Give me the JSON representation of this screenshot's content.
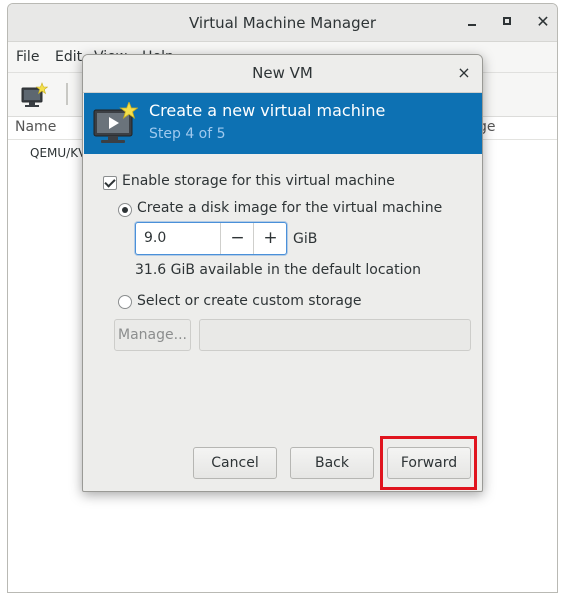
{
  "main_window": {
    "title": "Virtual Machine Manager",
    "menu": [
      "File",
      "Edit",
      "View",
      "Help"
    ],
    "columns": {
      "name": "Name",
      "usage": "ge"
    },
    "connection": "QEMU/KV"
  },
  "dialog": {
    "title": "New VM",
    "close_glyph": "×",
    "banner": {
      "title": "Create a new virtual machine",
      "step": "Step 4 of 5"
    },
    "enable_storage_label": "Enable storage for this virtual machine",
    "create_disk_label": "Create a disk image for the virtual machine",
    "disk_size": "9.0",
    "minus": "−",
    "plus": "+",
    "unit": "GiB",
    "available": "31.6 GiB available in the default location",
    "custom_storage_label": "Select or create custom storage",
    "manage_label": "Manage...",
    "custom_path": "",
    "buttons": {
      "cancel": "Cancel",
      "back": "Back",
      "forward": "Forward"
    }
  },
  "colors": {
    "banner": "#0d71b3",
    "highlight": "#e0141e"
  },
  "icons": [
    "new-vm-icon",
    "monitor-play-icon",
    "star-icon",
    "close-icon",
    "minimize-icon",
    "maximize-icon",
    "checkbox-icon",
    "radio-icon"
  ]
}
